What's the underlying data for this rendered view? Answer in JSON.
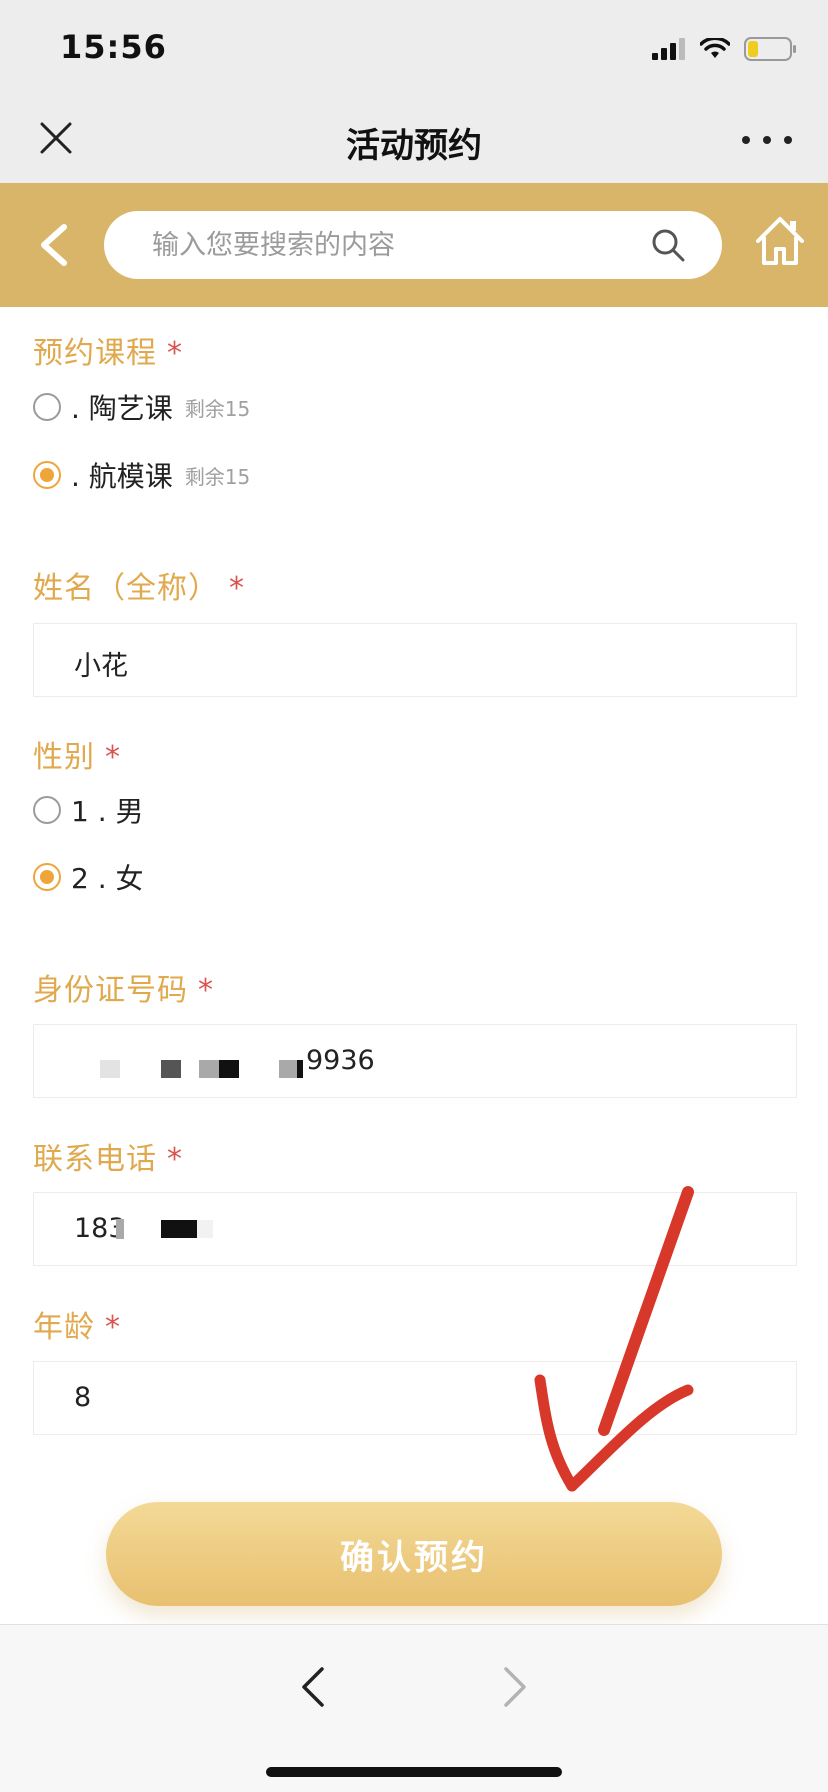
{
  "status_bar": {
    "time": "15:56",
    "icons": [
      "signal-icon",
      "wifi-icon",
      "battery-icon"
    ]
  },
  "title_bar": {
    "title": "活动预约",
    "close_icon": "close-icon",
    "more_icon": "more-icon"
  },
  "search": {
    "placeholder": "输入您要搜索的内容",
    "back_icon": "chevron-left-icon",
    "search_icon": "search-icon",
    "home_icon": "home-icon"
  },
  "form": {
    "course": {
      "label": "预约课程",
      "required_mark": "*",
      "options": [
        {
          "text": ". 陶艺课",
          "remain": "剩余15",
          "selected": false
        },
        {
          "text": ". 航模课",
          "remain": "剩余15",
          "selected": true
        }
      ]
    },
    "name": {
      "label": "姓名（全称）",
      "required_mark": "*",
      "value": "小花"
    },
    "gender": {
      "label": "性别",
      "required_mark": "*",
      "options": [
        {
          "text": "1 . 男",
          "selected": false
        },
        {
          "text": "2 . 女",
          "selected": true
        }
      ]
    },
    "id_number": {
      "label": "身份证号码",
      "required_mark": "*",
      "visible_value": "9936"
    },
    "phone": {
      "label": "联系电话",
      "required_mark": "*",
      "visible_value": "183"
    },
    "age": {
      "label": "年龄",
      "required_mark": "*",
      "value": "8"
    }
  },
  "confirm": {
    "label": "确认预约"
  },
  "bottom_nav": {
    "back_icon": "chevron-left-icon",
    "forward_icon": "chevron-right-icon"
  },
  "colors": {
    "gold_header": "#d9b56a",
    "label_gold": "#e0a94e",
    "radio_orange": "#eea63a",
    "required_red": "#d9534f",
    "annotation_red": "#d8382a"
  }
}
